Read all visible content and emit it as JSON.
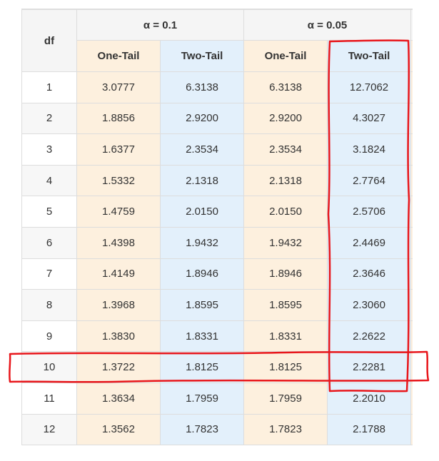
{
  "table": {
    "df_header": "df",
    "groups": [
      {
        "label": "α = 0.1"
      },
      {
        "label": "α = 0.05"
      }
    ],
    "subheaders": [
      "One-Tail",
      "Two-Tail",
      "One-Tail",
      "Two-Tail"
    ],
    "rows": [
      {
        "df": "1",
        "values": [
          "3.0777",
          "6.3138",
          "6.3138",
          "12.7062"
        ]
      },
      {
        "df": "2",
        "values": [
          "1.8856",
          "2.9200",
          "2.9200",
          "4.3027"
        ]
      },
      {
        "df": "3",
        "values": [
          "1.6377",
          "2.3534",
          "2.3534",
          "3.1824"
        ]
      },
      {
        "df": "4",
        "values": [
          "1.5332",
          "2.1318",
          "2.1318",
          "2.7764"
        ]
      },
      {
        "df": "5",
        "values": [
          "1.4759",
          "2.0150",
          "2.0150",
          "2.5706"
        ]
      },
      {
        "df": "6",
        "values": [
          "1.4398",
          "1.9432",
          "1.9432",
          "2.4469"
        ]
      },
      {
        "df": "7",
        "values": [
          "1.4149",
          "1.8946",
          "1.8946",
          "2.3646"
        ]
      },
      {
        "df": "8",
        "values": [
          "1.3968",
          "1.8595",
          "1.8595",
          "2.3060"
        ]
      },
      {
        "df": "9",
        "values": [
          "1.3830",
          "1.8331",
          "1.8331",
          "2.2622"
        ]
      },
      {
        "df": "10",
        "values": [
          "1.3722",
          "1.8125",
          "1.8125",
          "2.2281"
        ]
      },
      {
        "df": "11",
        "values": [
          "1.3634",
          "1.7959",
          "1.7959",
          "2.2010"
        ]
      },
      {
        "df": "12",
        "values": [
          "1.3562",
          "1.7823",
          "1.7823",
          "2.1788"
        ]
      }
    ]
  },
  "colors": {
    "one_tail_bg": "#fdf0de",
    "two_tail_bg": "#e3f0fb",
    "annotation": "#e8161b"
  }
}
